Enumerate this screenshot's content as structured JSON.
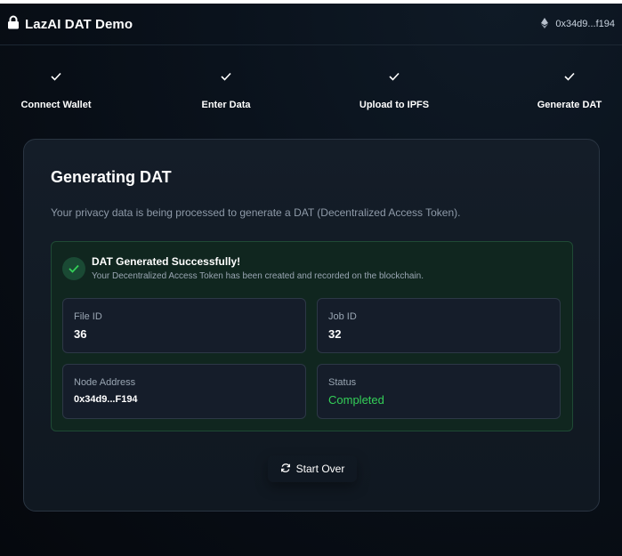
{
  "header": {
    "title": "LazAI DAT Demo",
    "wallet_address": "0x34d9...f194"
  },
  "steps": [
    {
      "label": "Connect Wallet",
      "done": true
    },
    {
      "label": "Enter Data",
      "done": true
    },
    {
      "label": "Upload to IPFS",
      "done": true
    },
    {
      "label": "Generate DAT",
      "done": true
    }
  ],
  "card": {
    "title": "Generating DAT",
    "description": "Your privacy data is being processed to generate a DAT (Decentralized Access Token).",
    "success": {
      "title": "DAT Generated Successfully!",
      "subtitle": "Your Decentralized Access Token has been created and recorded on the blockchain."
    },
    "fields": {
      "file_id": {
        "label": "File ID",
        "value": "36"
      },
      "job_id": {
        "label": "Job ID",
        "value": "32"
      },
      "node_address": {
        "label": "Node Address",
        "value": "0x34d9...F194"
      },
      "status": {
        "label": "Status",
        "value": "Completed"
      }
    },
    "start_over_label": "Start Over"
  },
  "colors": {
    "success_green": "#34d058",
    "success_bg": "#10261f",
    "card_border": "#2a3542"
  }
}
